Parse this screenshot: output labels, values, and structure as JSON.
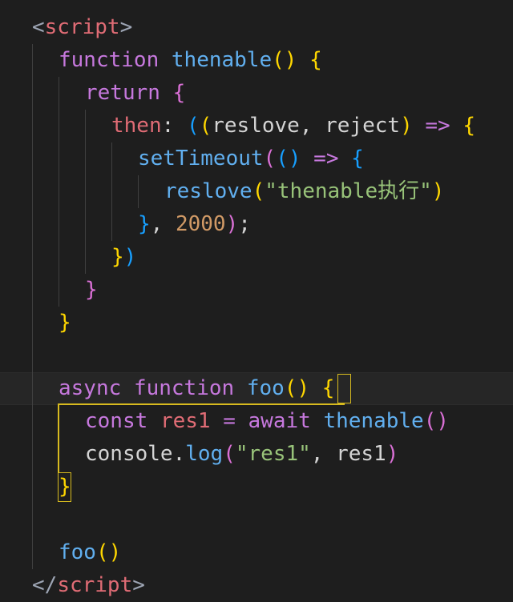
{
  "editor": {
    "lines": [
      {
        "tokens": [
          {
            "t": "<",
            "c": "punc"
          },
          {
            "t": "script",
            "c": "tag"
          },
          {
            "t": ">",
            "c": "punc"
          }
        ]
      },
      {
        "tokens": [
          {
            "t": "function",
            "c": "kw"
          },
          {
            "t": " ",
            "c": "plain"
          },
          {
            "t": "thenable",
            "c": "fn"
          },
          {
            "t": "()",
            "c": "b1"
          },
          {
            "t": " ",
            "c": "plain"
          },
          {
            "t": "{",
            "c": "b1"
          }
        ]
      },
      {
        "tokens": [
          {
            "t": "return",
            "c": "kw"
          },
          {
            "t": " ",
            "c": "plain"
          },
          {
            "t": "{",
            "c": "b2"
          }
        ]
      },
      {
        "tokens": [
          {
            "t": "then",
            "c": "prop"
          },
          {
            "t": ": ",
            "c": "plain"
          },
          {
            "t": "(",
            "c": "b3"
          },
          {
            "t": "(",
            "c": "b1"
          },
          {
            "t": "reslove, reject",
            "c": "plain"
          },
          {
            "t": ")",
            "c": "b1"
          },
          {
            "t": " ",
            "c": "plain"
          },
          {
            "t": "=>",
            "c": "kw"
          },
          {
            "t": " ",
            "c": "plain"
          },
          {
            "t": "{",
            "c": "b1"
          }
        ]
      },
      {
        "tokens": [
          {
            "t": "setTimeout",
            "c": "fn"
          },
          {
            "t": "(",
            "c": "b2"
          },
          {
            "t": "()",
            "c": "b3"
          },
          {
            "t": " ",
            "c": "plain"
          },
          {
            "t": "=>",
            "c": "kw"
          },
          {
            "t": " ",
            "c": "plain"
          },
          {
            "t": "{",
            "c": "b3"
          }
        ]
      },
      {
        "tokens": [
          {
            "t": "reslove",
            "c": "fn"
          },
          {
            "t": "(",
            "c": "b1"
          },
          {
            "t": "\"thenable执行\"",
            "c": "str"
          },
          {
            "t": ")",
            "c": "b1"
          }
        ]
      },
      {
        "tokens": [
          {
            "t": "}",
            "c": "b3"
          },
          {
            "t": ", ",
            "c": "plain"
          },
          {
            "t": "2000",
            "c": "num"
          },
          {
            "t": ")",
            "c": "b2"
          },
          {
            "t": ";",
            "c": "plain"
          }
        ]
      },
      {
        "tokens": [
          {
            "t": "}",
            "c": "b1"
          },
          {
            "t": ")",
            "c": "b3"
          }
        ]
      },
      {
        "tokens": [
          {
            "t": "}",
            "c": "b2"
          }
        ]
      },
      {
        "tokens": [
          {
            "t": "}",
            "c": "b1"
          }
        ]
      },
      {
        "tokens": []
      },
      {
        "tokens": [
          {
            "t": "async",
            "c": "kw"
          },
          {
            "t": " ",
            "c": "plain"
          },
          {
            "t": "function",
            "c": "kw"
          },
          {
            "t": " ",
            "c": "plain"
          },
          {
            "t": "foo",
            "c": "fn"
          },
          {
            "t": "()",
            "c": "b1"
          },
          {
            "t": " ",
            "c": "plain"
          },
          {
            "t": "{",
            "c": "b1"
          }
        ]
      },
      {
        "tokens": [
          {
            "t": "const",
            "c": "kw"
          },
          {
            "t": " ",
            "c": "plain"
          },
          {
            "t": "res1",
            "c": "prop"
          },
          {
            "t": " ",
            "c": "plain"
          },
          {
            "t": "=",
            "c": "kw"
          },
          {
            "t": " ",
            "c": "plain"
          },
          {
            "t": "await",
            "c": "kw"
          },
          {
            "t": " ",
            "c": "plain"
          },
          {
            "t": "thenable",
            "c": "fn"
          },
          {
            "t": "()",
            "c": "b2"
          }
        ]
      },
      {
        "tokens": [
          {
            "t": "console",
            "c": "plain"
          },
          {
            "t": ".",
            "c": "plain"
          },
          {
            "t": "log",
            "c": "fn"
          },
          {
            "t": "(",
            "c": "b2"
          },
          {
            "t": "\"res1\"",
            "c": "str"
          },
          {
            "t": ", res1",
            "c": "plain"
          },
          {
            "t": ")",
            "c": "b2"
          }
        ]
      },
      {
        "tokens": [
          {
            "t": "}",
            "c": "b1"
          }
        ]
      },
      {
        "tokens": []
      },
      {
        "tokens": [
          {
            "t": "foo",
            "c": "fn"
          },
          {
            "t": "()",
            "c": "b1"
          }
        ]
      },
      {
        "tokens": [
          {
            "t": "</",
            "c": "punc"
          },
          {
            "t": "script",
            "c": "tag"
          },
          {
            "t": ">",
            "c": "punc"
          }
        ]
      }
    ]
  },
  "colors": {
    "background": "#1e1e1e",
    "bracket_highlight": "#d7ba1f",
    "keyword": "#c678dd",
    "function": "#61afef",
    "string": "#98c379",
    "number": "#d19a66"
  }
}
